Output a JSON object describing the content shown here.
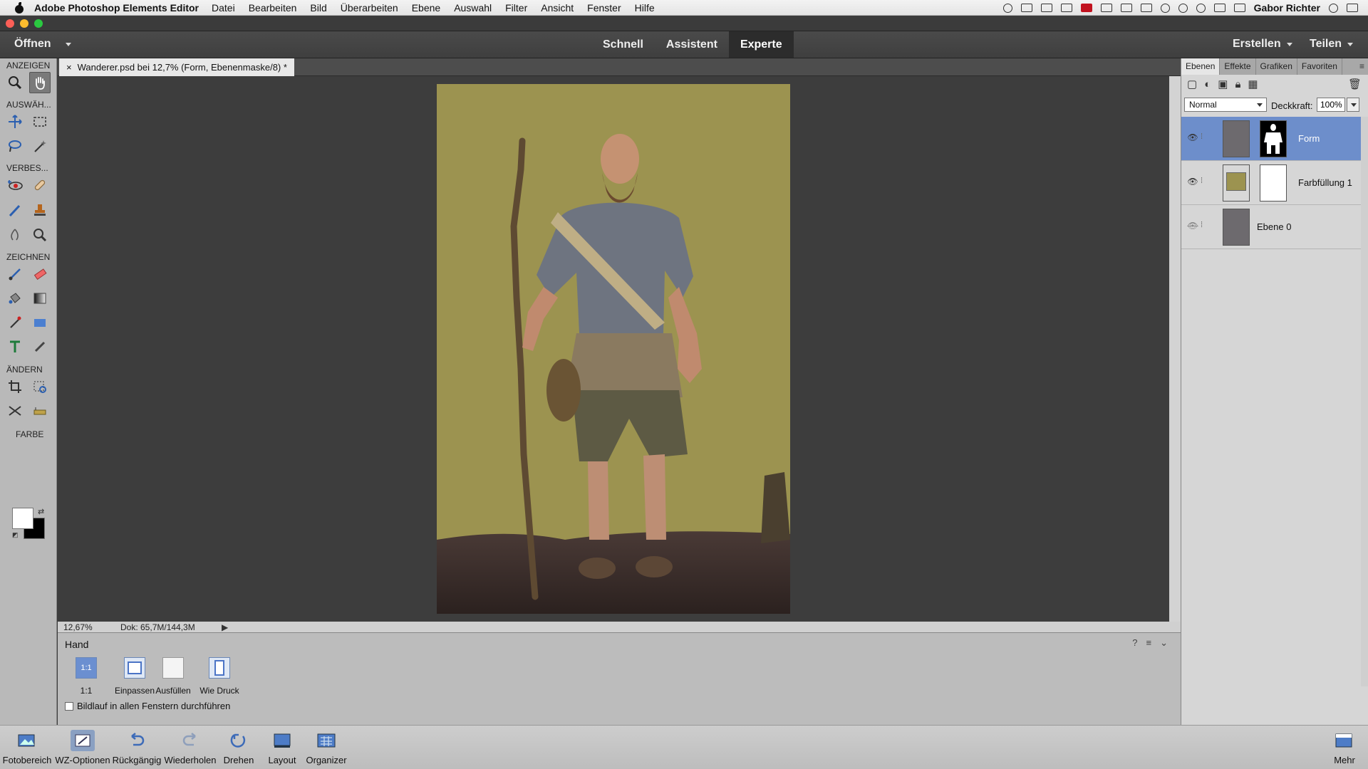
{
  "menubar": {
    "app_name": "Adobe Photoshop Elements Editor",
    "items": [
      "Datei",
      "Bearbeiten",
      "Bild",
      "Überarbeiten",
      "Ebene",
      "Auswahl",
      "Filter",
      "Ansicht",
      "Fenster",
      "Hilfe"
    ],
    "user": "Gabor Richter"
  },
  "topbar": {
    "open_label": "Öffnen",
    "modes": [
      "Schnell",
      "Assistent",
      "Experte"
    ],
    "active_mode": "Experte",
    "create_label": "Erstellen",
    "share_label": "Teilen"
  },
  "tools": {
    "groups": {
      "view": "ANZEIGEN",
      "select": "AUSWÄH...",
      "enhance": "VERBES...",
      "draw": "ZEICHNEN",
      "modify": "ÄNDERN",
      "color": "FARBE"
    }
  },
  "document": {
    "tab_title": "Wanderer.psd bei 12,7% (Form, Ebenenmaske/8) *",
    "close_glyph": "×",
    "zoom": "12,67%",
    "doc_info": "Dok: 65,7M/144,3M",
    "background_color": "#9c9350"
  },
  "tool_options": {
    "tool_name": "Hand",
    "zoom_buttons": [
      {
        "label": "1:1",
        "icon_text": "1:1"
      },
      {
        "label": "Einpassen",
        "icon_text": ""
      },
      {
        "label": "Ausfüllen",
        "icon_text": ""
      },
      {
        "label": "Wie Druck",
        "icon_text": ""
      }
    ],
    "scroll_all_label": "Bildlauf in allen Fenstern durchführen",
    "scroll_all_checked": false
  },
  "bottom": {
    "items": [
      "Fotobereich",
      "WZ-Optionen",
      "Rückgängig",
      "Wiederholen",
      "Drehen",
      "Layout",
      "Organizer"
    ],
    "more": "Mehr"
  },
  "layers": {
    "tabs": [
      "Ebenen",
      "Effekte",
      "Grafiken",
      "Favoriten"
    ],
    "blend_mode": "Normal",
    "opacity_label": "Deckkraft:",
    "opacity": "100%",
    "list": [
      {
        "name": "Form",
        "selected": true,
        "visible": true
      },
      {
        "name": "Farbfüllung 1",
        "selected": false,
        "visible": true
      },
      {
        "name": "Ebene 0",
        "selected": false,
        "visible": false
      }
    ]
  },
  "colors": {
    "accent": "#6d8ecb",
    "fill_color": "#9c9350",
    "foreground": "#ffffff",
    "background": "#000000"
  }
}
